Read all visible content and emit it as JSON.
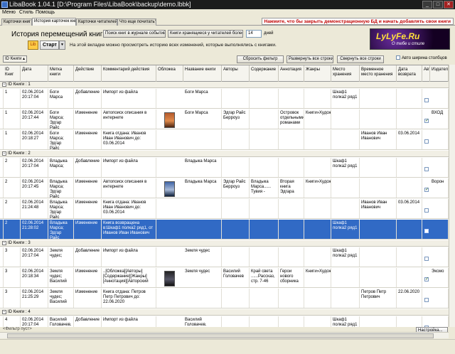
{
  "window": {
    "title": "LibaBook 1.04.1 [D:\\Program Files\\LibaBook\\backup\\demo.lbbk]",
    "minimize": "_",
    "maximize": "□",
    "close": "✕"
  },
  "menu": [
    "Меню",
    "Стиль",
    "Помощь"
  ],
  "tabs": [
    "Карточки книг",
    "История карточек книг",
    "Карточки читателей",
    "Что еще почитать?"
  ],
  "warning": "Нажмите, что бы закрыть демонстрационную БД и начать добавлять свои книги",
  "toolbar": {
    "heading": "История перемещений книг",
    "btn_journal": "Поиск книг в журнале событий",
    "btn_readers": "Книги хранящиеся у читателей более",
    "days_value": "14",
    "days_label": "дней",
    "start_icon": "Lib",
    "start_label": "Старт",
    "hint": "На этой вкладке можно просмотреть историю всех изменений, которые выполнялись с книгами."
  },
  "logo": {
    "line1": "LyLyFe.Ru",
    "line2": "О тебе и стиле"
  },
  "filter": {
    "group_chip": "ID Книги",
    "reset_filter": "Сбросить фильтр",
    "expand_all": "Развернуть все строки",
    "collapse_all": "Свернуть все строки",
    "auto_width": "Авто ширина столбцов"
  },
  "columns": [
    "ID Книг",
    "Дата",
    "Метка книги",
    "Действие",
    "Комментарий действия",
    "Обложка",
    "Название книги",
    "Авторы",
    "Содержание",
    "Аннотация",
    "Жанры",
    "Место хранения",
    "Временное место хранения",
    "Дата возврата",
    "Авто",
    "Издатель"
  ],
  "groups": [
    {
      "label": "ID Книги : 1",
      "rows": [
        {
          "id": "1",
          "date": "02.06.2014 20:17:04",
          "tag": "Боги Марса",
          "action": "Добавление",
          "comment": "Импорт из файла",
          "cover": "",
          "title": "Боги Марса",
          "authors": "",
          "content": "",
          "annotation": "",
          "genres": "",
          "place": "Шкаф1 полка2 ряд1",
          "temp": "",
          "return": "",
          "auto": false,
          "publisher": ""
        },
        {
          "id": "1",
          "date": "02.06.2014 20:17:44",
          "tag": "Боги Марса; Эдгар Райс",
          "action": "Изменение",
          "comment": "Автопоиск описания в интернете",
          "cover": "c1",
          "title": "Боги Марса",
          "authors": "Эдгар Райс Берроуз",
          "content": "",
          "annotation": "Островок отдельными романами",
          "genres": "Книги»Художественная",
          "place": "",
          "temp": "",
          "return": "",
          "auto": true,
          "publisher": "ВХОД"
        },
        {
          "id": "1",
          "date": "02.06.2014 20:18:27",
          "tag": "Боги Марса; Эдгар Райс",
          "action": "Изменение",
          "comment": "Книга отдана: Иванов Иван Иванович до: 03.06.2014",
          "cover": "",
          "title": "",
          "authors": "",
          "content": "",
          "annotation": "",
          "genres": "",
          "place": "",
          "temp": "Иванов Иван Иванович",
          "return": "03.06.2014",
          "auto": false,
          "publisher": ""
        }
      ]
    },
    {
      "label": "ID Книги : 2",
      "rows": [
        {
          "id": "2",
          "date": "02.06.2014 20:17:04",
          "tag": "Владыка Марса;",
          "action": "Добавление",
          "comment": "Импорт из файла",
          "cover": "",
          "title": "Владыка Марса",
          "authors": "",
          "content": "",
          "annotation": "",
          "genres": "",
          "place": "Шкаф1 полка2 ряд1",
          "temp": "",
          "return": "",
          "auto": false,
          "publisher": ""
        },
        {
          "id": "2",
          "date": "02.06.2014 20:17:45",
          "tag": "Владыка Марса; Эдгар Райс",
          "action": "Изменение",
          "comment": "Автопоиск описания в интернете",
          "cover": "c2",
          "title": "Владыка Марса",
          "authors": "Эдгар Райс Берроуз",
          "content": "Владыка Марса...... Тувия -",
          "annotation": "Вторая книга Эдгара",
          "genres": "Книги»Художественная",
          "place": "",
          "temp": "",
          "return": "",
          "auto": true,
          "publisher": "Ворон"
        },
        {
          "id": "2",
          "date": "02.06.2014 21:24:48",
          "tag": "Владыка Марса; Эдгар Райс",
          "action": "Изменение",
          "comment": "Книга отдана: Иванов Иван Иванович до: 03.06.2014",
          "cover": "",
          "title": "",
          "authors": "",
          "content": "",
          "annotation": "",
          "genres": "",
          "place": "",
          "temp": "Иванов Иван Иванович",
          "return": "03.06.2014",
          "auto": false,
          "publisher": ""
        },
        {
          "id": "2",
          "date": "02.06.2014 21:28:02",
          "tag": "Владыка Марса; Эдгар Райс",
          "action": "Изменение",
          "comment": "Книга возвращена в:Шкаф1 полка2 ряд1, от Иванов Иван Иванович",
          "cover": "",
          "title": "",
          "authors": "",
          "content": "",
          "annotation": "",
          "genres": "",
          "place": "Шкаф1 полка2 ряд1",
          "temp": "",
          "return": "",
          "auto": false,
          "publisher": "",
          "selected": true
        }
      ]
    },
    {
      "label": "ID Книги : 3",
      "rows": [
        {
          "id": "3",
          "date": "02.06.2014 20:17:04",
          "tag": "Земля чудес;",
          "action": "Добавление",
          "comment": "Импорт из файла",
          "cover": "",
          "title": "Земля чудес",
          "authors": "",
          "content": "",
          "annotation": "",
          "genres": "",
          "place": "Шкаф1 полка2 ряд1",
          "temp": "",
          "return": "",
          "auto": false,
          "publisher": ""
        },
        {
          "id": "3",
          "date": "02.06.2014 20:18:34",
          "tag": "Земля чудес; Василий",
          "action": "Изменение",
          "comment": "..[Обложка][Авторы][Содержание][Жанры][Аннотация][Авторский",
          "cover": "c3",
          "title": "Земля чудес",
          "authors": "Василий Головачев",
          "content": "Край света ......Рассказ, стр. 7-46",
          "annotation": "Герои нового сборника",
          "genres": "Книги»Художественная",
          "place": "",
          "temp": "",
          "return": "",
          "auto": true,
          "publisher": "Эксмо"
        },
        {
          "id": "3",
          "date": "02.06.2014 21:25:29",
          "tag": "Земля чудес; Василий",
          "action": "Изменение",
          "comment": "Книга отдана: Петров Петр Петрович до: 22.06.2020",
          "cover": "",
          "title": "",
          "authors": "",
          "content": "",
          "annotation": "",
          "genres": "",
          "place": "",
          "temp": "Петров Петр Петрович",
          "return": "22.06.2020",
          "auto": false,
          "publisher": ""
        }
      ]
    },
    {
      "label": "ID Книги : 4",
      "rows": [
        {
          "id": "4",
          "date": "02.06.2014 20:17:04",
          "tag": "Василий Головачев.",
          "action": "Добавление",
          "comment": "Импорт из файла",
          "cover": "",
          "title": "Василий Головачев.",
          "authors": "",
          "content": "",
          "annotation": "",
          "genres": "",
          "place": "Шкаф1 полка2 ряд1",
          "temp": "",
          "return": "",
          "auto": false,
          "publisher": ""
        }
      ]
    }
  ],
  "status": {
    "filter_empty": "<Фильтр пуст>",
    "setup": "Настройка..."
  }
}
